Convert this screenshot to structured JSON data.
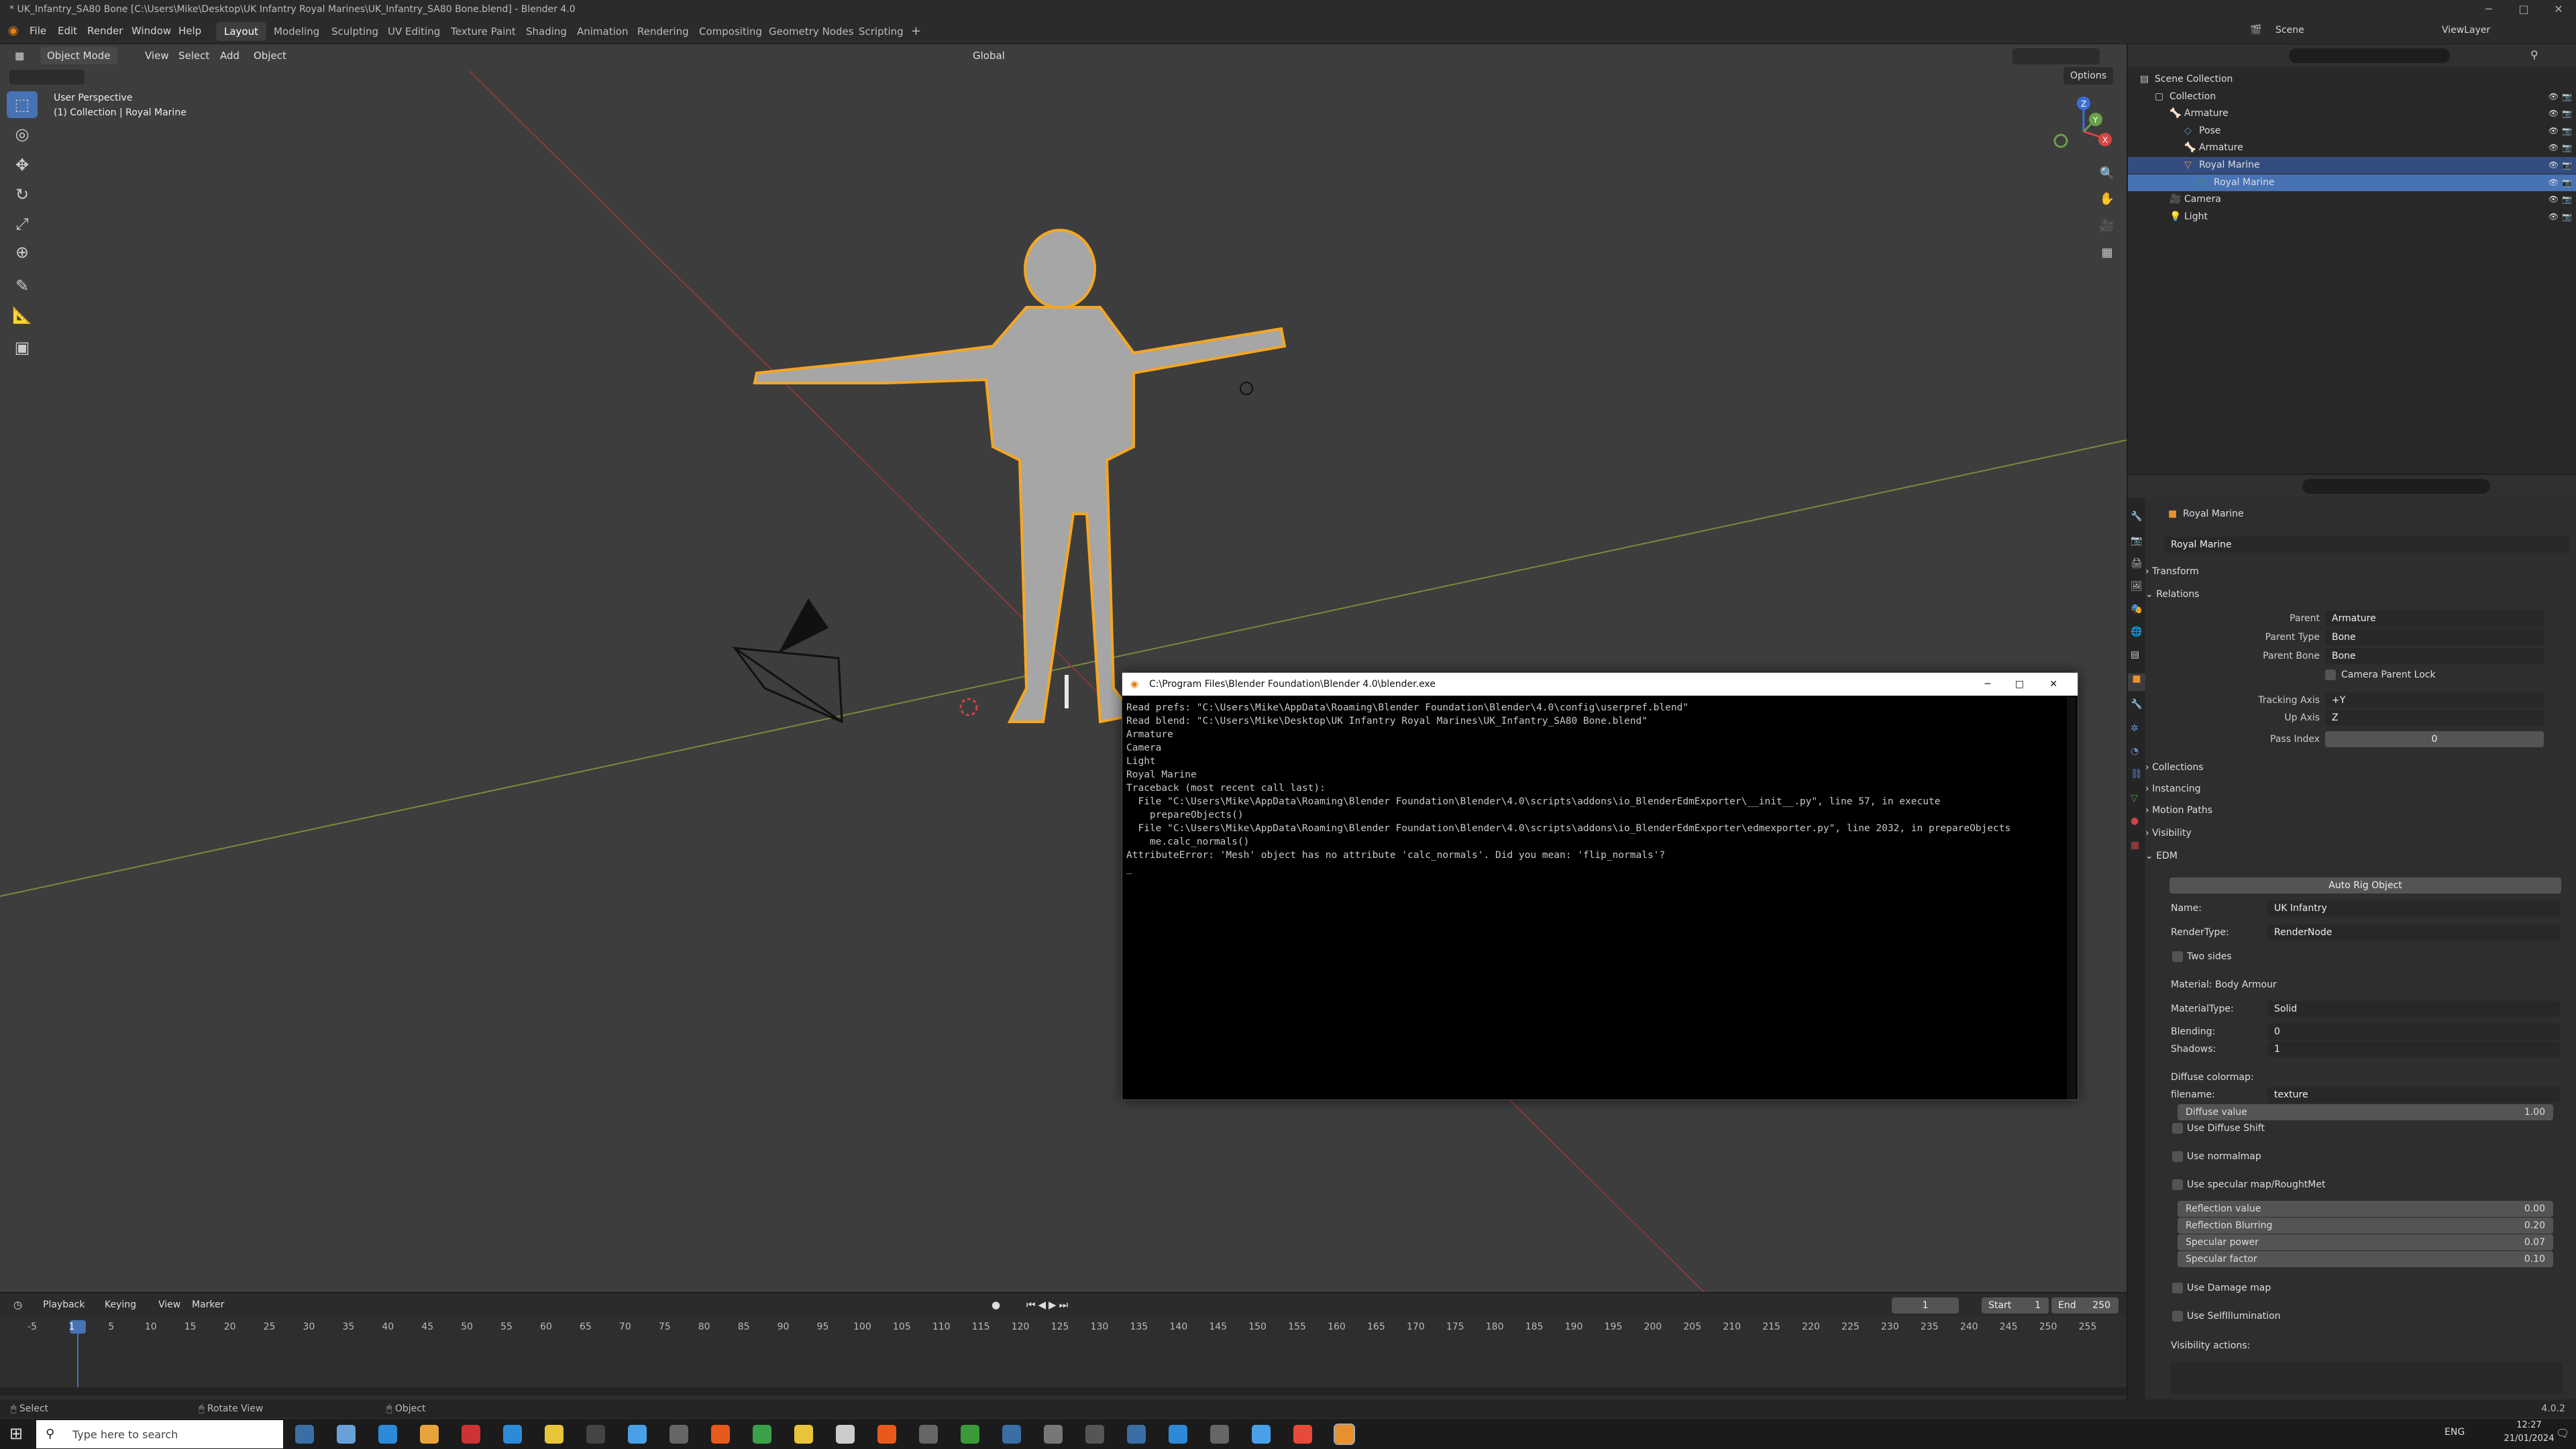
{
  "window": {
    "title": "* UK_Infantry_SA80 Bone [C:\\Users\\Mike\\Desktop\\UK Infantry Royal Marines\\UK_Infantry_SA80 Bone.blend] - Blender 4.0"
  },
  "menu": [
    "File",
    "Edit",
    "Render",
    "Window",
    "Help"
  ],
  "workspaces": [
    "Layout",
    "Modeling",
    "Sculpting",
    "UV Editing",
    "Texture Paint",
    "Shading",
    "Animation",
    "Rendering",
    "Compositing",
    "Geometry Nodes",
    "Scripting"
  ],
  "top_right": {
    "scene": "Scene",
    "view_layer": "ViewLayer"
  },
  "viewport": {
    "mode": "Object Mode",
    "menus": [
      "View",
      "Select",
      "Add",
      "Object"
    ],
    "transform_orientation": "Global",
    "options_label": "Options",
    "overlay_line1": "User Perspective",
    "overlay_line2": "(1) Collection | Royal Marine",
    "gizmo": {
      "x": "X",
      "y": "Y",
      "z": "Z"
    }
  },
  "console": {
    "title": "C:\\Program Files\\Blender Foundation\\Blender 4.0\\blender.exe",
    "lines": [
      "Read prefs: \"C:\\Users\\Mike\\AppData\\Roaming\\Blender Foundation\\Blender\\4.0\\config\\userpref.blend\"",
      "Read blend: \"C:\\Users\\Mike\\Desktop\\UK Infantry Royal Marines\\UK_Infantry_SA80 Bone.blend\"",
      "Armature",
      "Camera",
      "Light",
      "Royal Marine",
      "Traceback (most recent call last):",
      "  File \"C:\\Users\\Mike\\AppData\\Roaming\\Blender Foundation\\Blender\\4.0\\scripts\\addons\\io_BlenderEdmExporter\\__init__.py\", line 57, in execute",
      "    prepareObjects()",
      "  File \"C:\\Users\\Mike\\AppData\\Roaming\\Blender Foundation\\Blender\\4.0\\scripts\\addons\\io_BlenderEdmExporter\\edmexporter.py\", line 2032, in prepareObjects",
      "    me.calc_normals()",
      "AttributeError: 'Mesh' object has no attribute 'calc_normals'. Did you mean: 'flip_normals'?",
      "_"
    ]
  },
  "outliner": {
    "rows": [
      {
        "label": "Scene Collection",
        "indent": 0
      },
      {
        "label": "Collection",
        "indent": 1
      },
      {
        "label": "Armature",
        "indent": 2
      },
      {
        "label": "Pose",
        "indent": 3
      },
      {
        "label": "Armature",
        "indent": 3
      },
      {
        "label": "Royal Marine",
        "indent": 3
      },
      {
        "label": "Royal Marine",
        "indent": 4
      },
      {
        "label": "Camera",
        "indent": 2
      },
      {
        "label": "Light",
        "indent": 2
      }
    ]
  },
  "properties": {
    "object_name": "Royal Marine",
    "object_field": "Royal Marine",
    "sections": {
      "transform": "Transform",
      "relations": "Relations",
      "collections": "Collections",
      "instancing": "Instancing",
      "motion_paths": "Motion Paths",
      "visibility": "Visibility",
      "edm": "EDM"
    },
    "relations": {
      "parent_label": "Parent",
      "parent_value": "Armature",
      "parent_type_label": "Parent Type",
      "parent_type_value": "Bone",
      "parent_bone_label": "Parent Bone",
      "parent_bone_value": "Bone",
      "camera_parent_lock": "Camera Parent Lock",
      "tracking_axis_label": "Tracking Axis",
      "tracking_axis_value": "+Y",
      "up_axis_label": "Up Axis",
      "up_axis_value": "Z",
      "pass_index_label": "Pass Index",
      "pass_index_value": "0"
    },
    "edm": {
      "auto_rig": "Auto Rig Object",
      "name_label": "Name:",
      "name_value": "UK Infantry",
      "render_type_label": "RenderType:",
      "render_type_value": "RenderNode",
      "two_sides": "Two sides",
      "material": "Material: Body Armour",
      "material_type_label": "MaterialType:",
      "material_type_value": "Solid",
      "blending_label": "Blending:",
      "blending_value": "0",
      "shadows_label": "Shadows:",
      "shadows_value": "1",
      "diffuse_colormap": "Diffuse colormap:",
      "filename_label": "filename:",
      "filename_value": "texture",
      "diffuse_value_label": "Diffuse value",
      "diffuse_value": "1.00",
      "use_diffuse_shift": "Use Diffuse Shift",
      "use_normalmap": "Use normalmap",
      "use_specular": "Use specular map/RoughtMet",
      "reflection_value_label": "Reflection value",
      "reflection_value": "0.00",
      "reflection_blurring_label": "Reflection Blurring",
      "reflection_blurring": "0.20",
      "specular_power_label": "Specular power",
      "specular_power": "0.07",
      "specular_factor_label": "Specular factor",
      "specular_factor": "0.10",
      "use_damage_map": "Use Damage map",
      "use_selfillumination": "Use SelfIllumination",
      "visibility_actions": "Visibility actions:"
    }
  },
  "timeline": {
    "menus": [
      "Playback",
      "Keying",
      "View",
      "Marker"
    ],
    "current_frame": "1",
    "start_label": "Start",
    "start_value": "1",
    "end_label": "End",
    "end_value": "250",
    "ticks": [
      "-5",
      "1",
      "5",
      "10",
      "15",
      "20",
      "25",
      "30",
      "35",
      "40",
      "45",
      "50",
      "55",
      "60",
      "65",
      "70",
      "75",
      "80",
      "85",
      "90",
      "95",
      "100",
      "105",
      "110",
      "115",
      "120",
      "125",
      "130",
      "135",
      "140",
      "145",
      "150",
      "155",
      "160",
      "165",
      "170",
      "175",
      "180",
      "185",
      "190",
      "195",
      "200",
      "205",
      "210",
      "215",
      "220",
      "225",
      "230",
      "235",
      "240",
      "245",
      "250",
      "255"
    ]
  },
  "status": {
    "select": "Select",
    "rotate": "Rotate View",
    "object": "Object",
    "version": "4.0.2"
  },
  "taskbar": {
    "search_placeholder": "Type here to search",
    "language": "ENG",
    "time": "12:27",
    "date": "21/01/2024"
  },
  "colors": {
    "accent": "#4772b3",
    "selection": "#f5a623",
    "viewport_bg": "#3d3d3d"
  }
}
